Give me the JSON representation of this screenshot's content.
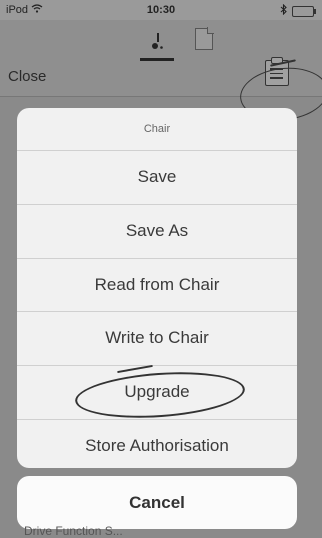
{
  "statusbar": {
    "carrier": "iPod",
    "time": "10:30",
    "icons": [
      "wifi-icon",
      "bluetooth-icon",
      "battery-icon"
    ]
  },
  "navbar": {
    "close_label": "Close",
    "tabs": [
      "wheelchair-icon",
      "document-icon"
    ],
    "right_button": "clipboard-icon"
  },
  "action_sheet": {
    "title": "Chair",
    "items": [
      {
        "label": "Save"
      },
      {
        "label": "Save As"
      },
      {
        "label": "Read from Chair"
      },
      {
        "label": "Write to Chair"
      },
      {
        "label": "Upgrade"
      },
      {
        "label": "Store Authorisation"
      }
    ],
    "cancel_label": "Cancel"
  },
  "background": {
    "partial_text": "Drive Function S..."
  },
  "colors": {
    "overlay": "#8a8a8a",
    "sheet": "#f1f1f1",
    "text": "#3a3a3a",
    "annotation": "#333333"
  }
}
